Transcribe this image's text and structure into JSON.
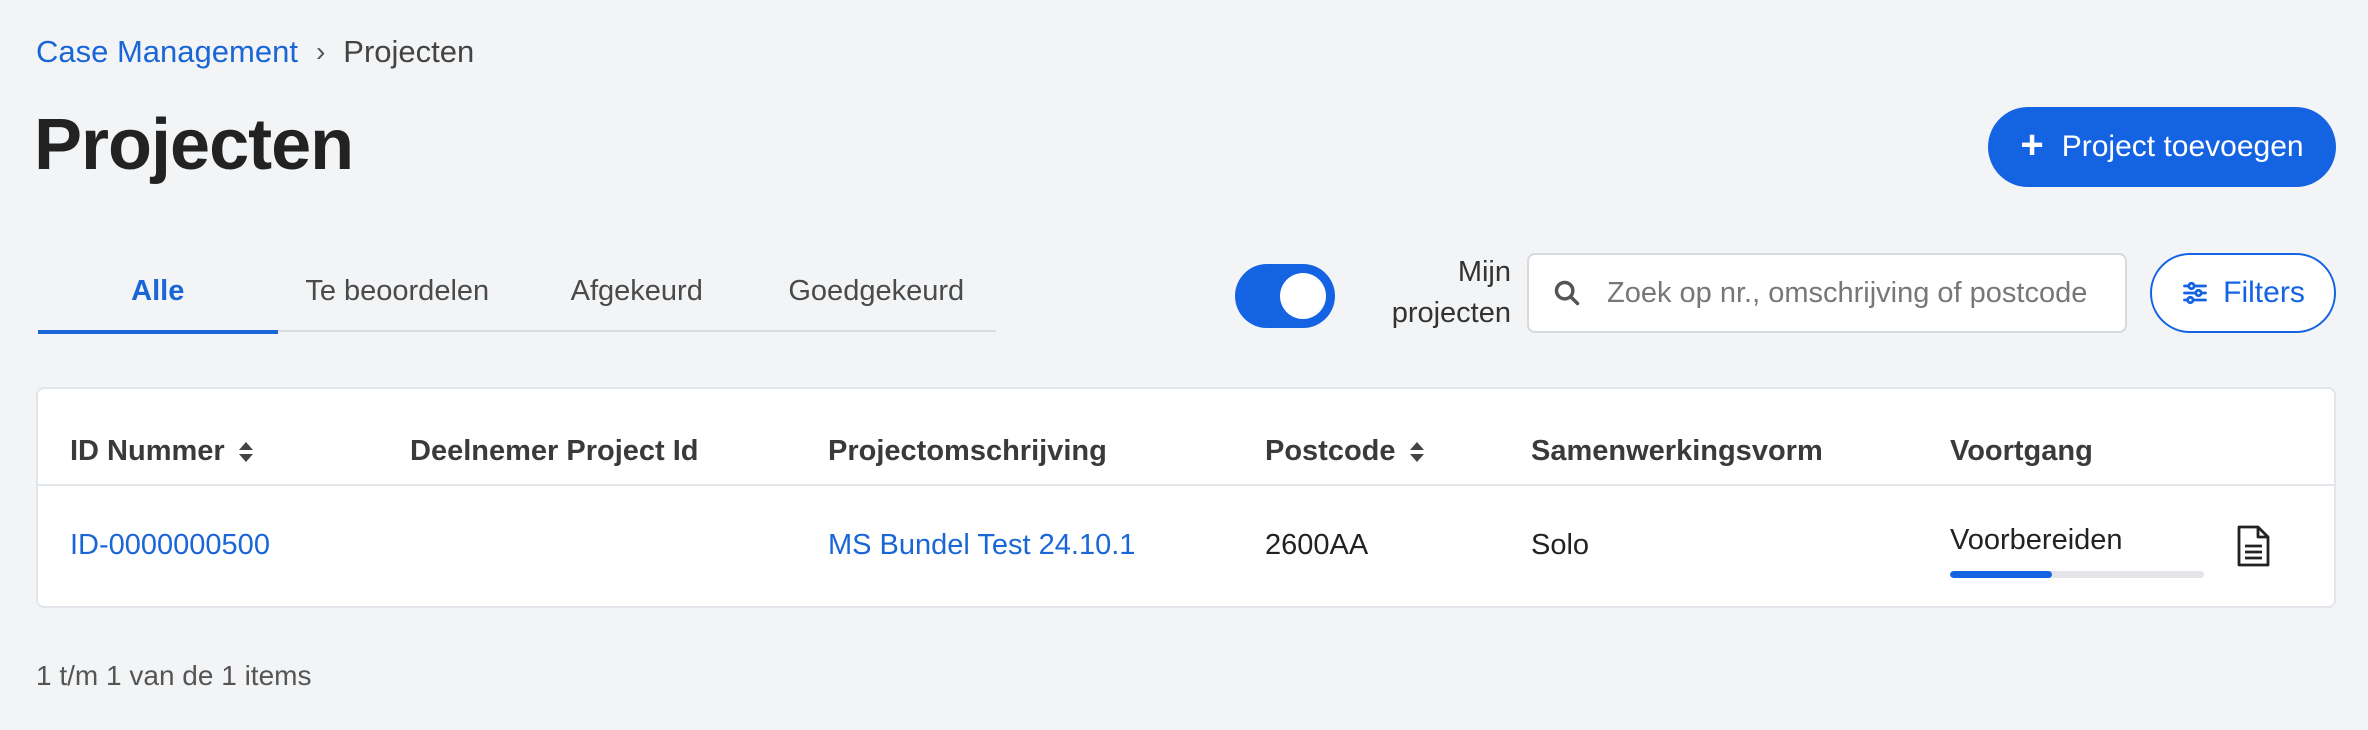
{
  "breadcrumb": {
    "root": "Case Management",
    "separator": "›",
    "current": "Projecten"
  },
  "page_title": "Projecten",
  "add_button": {
    "label": "Project toevoegen",
    "icon": "plus-icon"
  },
  "tabs": [
    {
      "label": "Alle",
      "active": true
    },
    {
      "label": "Te beoordelen",
      "active": false
    },
    {
      "label": "Afgekeurd",
      "active": false
    },
    {
      "label": "Goedgekeurd",
      "active": false
    }
  ],
  "my_projects_toggle": {
    "label": "Mijn projecten",
    "on": true
  },
  "search": {
    "placeholder": "Zoek op nr., omschrijving of postcode",
    "value": ""
  },
  "filters_button": {
    "label": "Filters",
    "icon": "sliders-icon"
  },
  "table": {
    "columns": [
      "ID Nummer",
      "Deelnemer Project Id",
      "Projectomschrijving",
      "Postcode",
      "Samenwerkingsvorm",
      "Voortgang"
    ],
    "sortable": [
      "ID Nummer",
      "Postcode"
    ],
    "rows": [
      {
        "id": "ID-0000000500",
        "participant_project_id": "",
        "description": "MS Bundel Test 24.10.1",
        "postcode": "2600AA",
        "cooperation": "Solo",
        "progress_label": "Voorbereiden",
        "progress_fraction": 0.4,
        "action_icon": "document-icon"
      }
    ]
  },
  "pagination_text": "1 t/m 1 van de 1 items",
  "colors": {
    "accent": "#1463e3",
    "link": "#1a66d6",
    "background": "#f3f4f6"
  }
}
